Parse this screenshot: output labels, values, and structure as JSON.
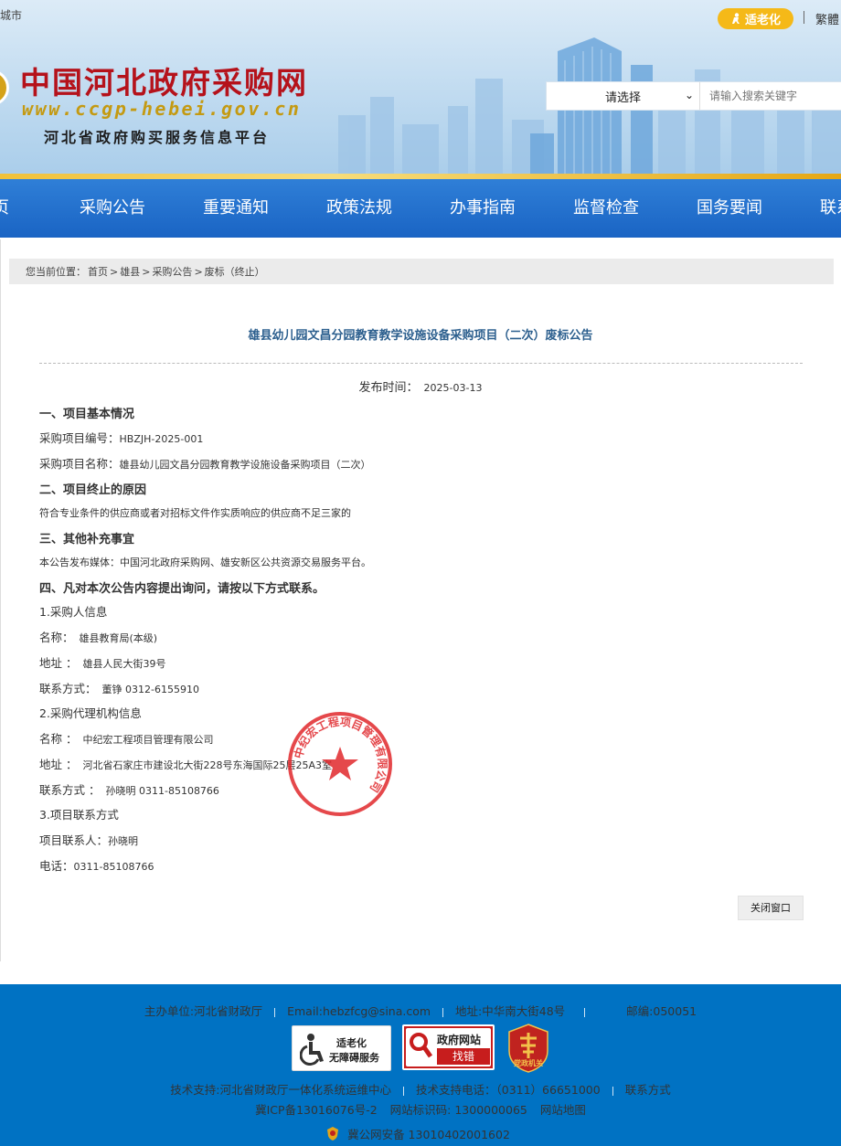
{
  "header": {
    "corner_text": "城市",
    "elder_mode_label": "适老化",
    "traditional_label": "繁體",
    "site_title": "中国河北政府采购网",
    "site_url": "www.ccgp-hebei.gov.cn",
    "site_subtitle": "河北省政府购买服务信息平台",
    "search": {
      "select_value": "请选择",
      "placeholder": "请输入搜索关键字"
    }
  },
  "nav": {
    "items": [
      "页",
      "采购公告",
      "重要通知",
      "政策法规",
      "办事指南",
      "监督检查",
      "国务要闻",
      "联系"
    ]
  },
  "breadcrumb": {
    "prefix": "您当前位置：",
    "items": [
      "首页",
      "雄县",
      "采购公告",
      "废标（终止）"
    ],
    "separator": ">"
  },
  "article": {
    "title": "雄县幼儿园文昌分园教育教学设施设备采购项目（二次）废标公告",
    "publish_label": "发布时间：",
    "publish_date": "2025-03-13",
    "sec1_heading": "一、项目基本情况",
    "project_no_label": "采购项目编号：",
    "project_no": "HBZJH-2025-001",
    "project_name_label": "采购项目名称：",
    "project_name": "雄县幼儿园文昌分园教育教学设施设备采购项目（二次）",
    "sec2_heading": "二、项目终止的原因",
    "termination_reason": "符合专业条件的供应商或者对招标文件作实质响应的供应商不足三家的",
    "sec3_heading": "三、其他补充事宜",
    "media_notice": "本公告发布媒体：中国河北政府采购网、雄安新区公共资源交易服务平台。",
    "sec4_heading": "四、凡对本次公告内容提出询问，请按以下方式联系。",
    "purchaser_heading": "1.采购人信息",
    "purchaser_name_label": "名称：",
    "purchaser_name": "雄县教育局(本级)",
    "purchaser_addr_label": "地址 ：",
    "purchaser_addr": "雄县人民大街39号",
    "purchaser_contact_label": "联系方式：",
    "purchaser_contact": "董铮 0312-6155910",
    "agency_heading": "2.采购代理机构信息",
    "agency_name_label": "名称 ：",
    "agency_name": "中纪宏工程项目管理有限公司",
    "agency_addr_label": "地址 ：",
    "agency_addr": "河北省石家庄市建设北大街228号东海国际25层25A3室",
    "agency_contact_label": "联系方式 ：",
    "agency_contact": "孙晓明 0311-85108766",
    "project_contact_heading": "3.项目联系方式",
    "project_person_label": "项目联系人：",
    "project_person": "孙晓明",
    "project_phone_label": "电话：",
    "project_phone": "0311-85108766",
    "stamp_text": "中纪宏工程项目管理有限公司",
    "close_button": "关闭窗口"
  },
  "footer": {
    "row1": [
      "主办单位:河北省财政厅",
      "Email:hebzfcg@sina.com",
      "地址:中华南大街48号",
      "邮编:050051"
    ],
    "badge_elder_line1": "适老化",
    "badge_elder_line2": "无障碍服务",
    "badge_gov_line1": "政府网站",
    "badge_gov_line2": "找错",
    "badge_party": "党政机关",
    "row2": [
      "技术支持:河北省财政厅一体化系统运维中心",
      "技术支持电话：（0311）66651000",
      "联系方式"
    ],
    "row3": [
      "冀ICP备13016076号-2",
      "网站标识码: 1300000065",
      "网站地图"
    ],
    "row4": "冀公网安备 13010402001602"
  },
  "colors": {
    "nav_blue": "#1a64c4",
    "footer_blue": "#0072c3",
    "title_red": "#b5121b",
    "elder_yellow": "#f5b918",
    "article_title_blue": "#2c5f8e",
    "stamp_red": "#e0282c"
  }
}
